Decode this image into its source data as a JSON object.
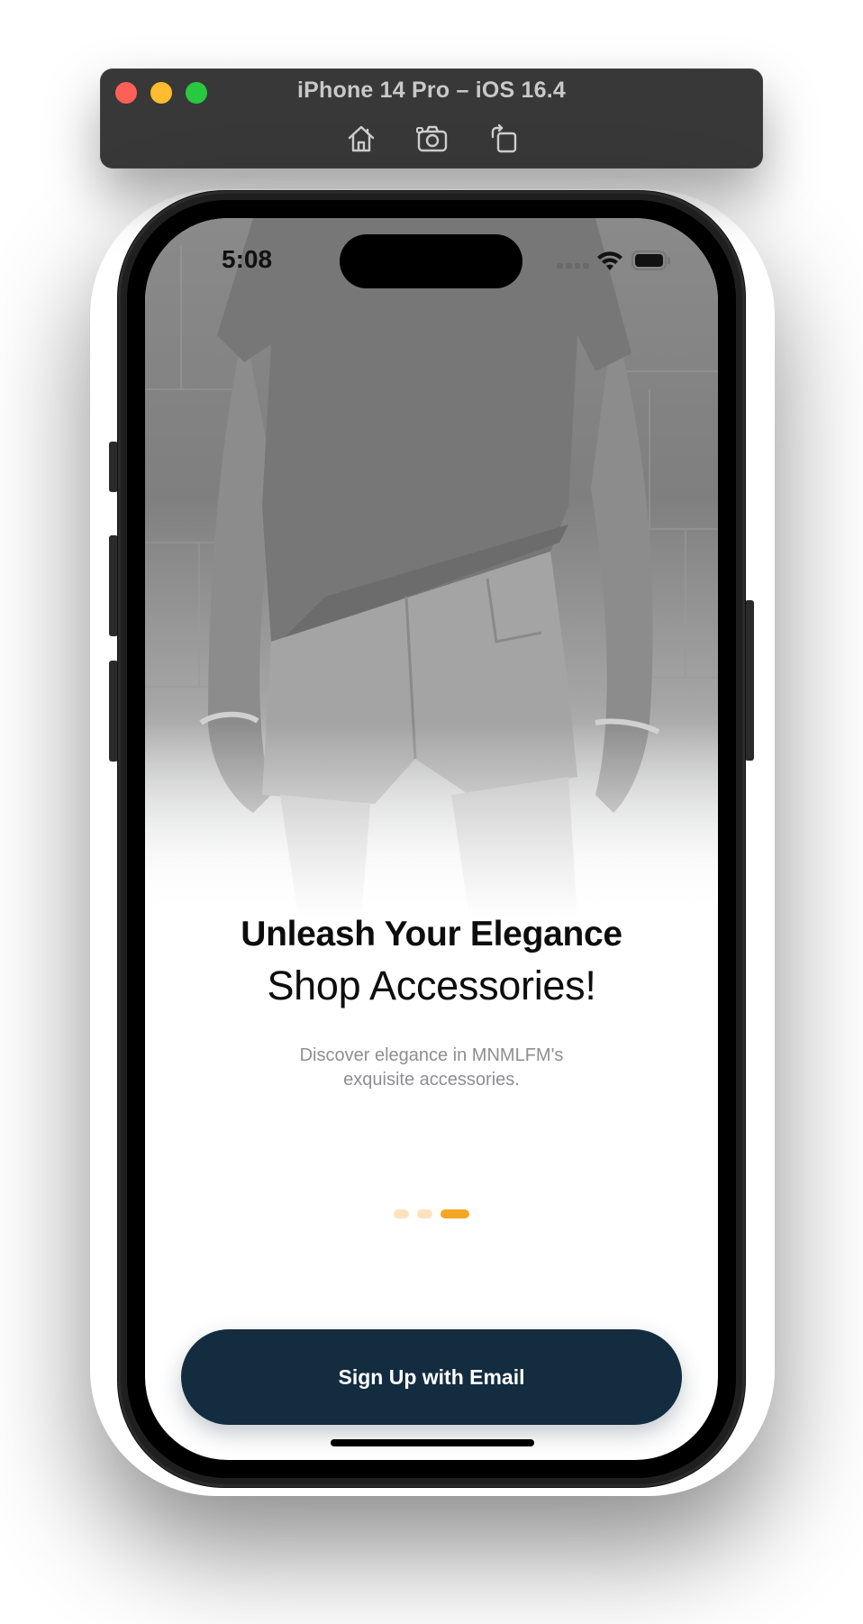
{
  "simulator": {
    "title": "iPhone 14 Pro – iOS 16.4",
    "toolbar_icons": [
      "home-icon",
      "screenshot-icon",
      "rotate-icon"
    ]
  },
  "status_bar": {
    "time": "5:08",
    "icons": [
      "cellular-icon",
      "wifi-icon",
      "battery-icon"
    ]
  },
  "onboarding": {
    "headline": "Unleash Your Elegance",
    "subheadline": "Shop Accessories!",
    "description": "Discover elegance in MNMLFM's exquisite accessories.",
    "pager": {
      "count": 3,
      "active_index": 2,
      "active_color": "#f5a623",
      "inactive_color": "#fde3bd"
    },
    "cta_label": "Sign Up with Email",
    "cta_color": "#132c40"
  }
}
